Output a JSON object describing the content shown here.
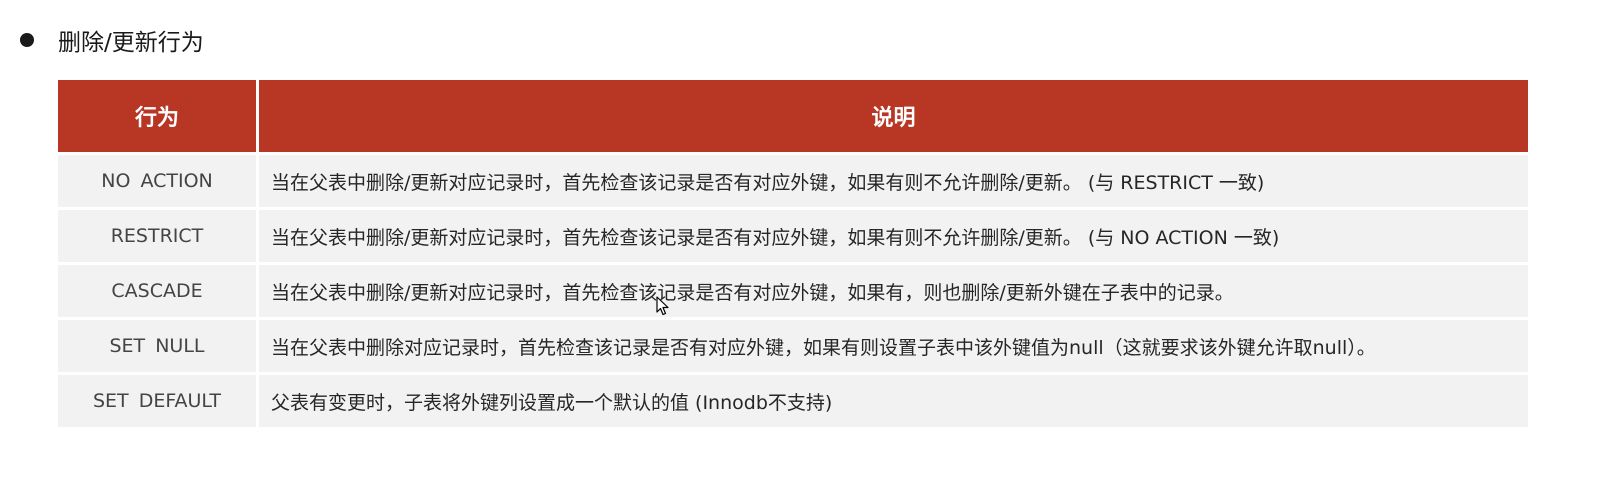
{
  "heading": {
    "text": "删除/更新行为"
  },
  "table": {
    "headers": {
      "behavior": "行为",
      "description": "说明"
    },
    "rows": [
      {
        "behavior": "NO  ACTION",
        "description": "当在父表中删除/更新对应记录时，首先检查该记录是否有对应外键，如果有则不允许删除/更新。 (与 RESTRICT 一致)"
      },
      {
        "behavior": "RESTRICT",
        "description": "当在父表中删除/更新对应记录时，首先检查该记录是否有对应外键，如果有则不允许删除/更新。 (与 NO ACTION 一致)"
      },
      {
        "behavior": "CASCADE",
        "description": "当在父表中删除/更新对应记录时，首先检查该记录是否有对应外键，如果有，则也删除/更新外键在子表中的记录。"
      },
      {
        "behavior": "SET  NULL",
        "description": "当在父表中删除对应记录时，首先检查该记录是否有对应外键，如果有则设置子表中该外键值为null（这就要求该外键允许取null）。"
      },
      {
        "behavior": "SET  DEFAULT",
        "description": "父表有变更时，子表将外键列设置成一个默认的值 (Innodb不支持)"
      }
    ]
  },
  "colors": {
    "header_bg": "#b83624",
    "row_bg": "#f2f2f2"
  },
  "icons": {
    "bullet": "bullet-dot-icon",
    "cursor": "mouse-pointer-icon"
  }
}
